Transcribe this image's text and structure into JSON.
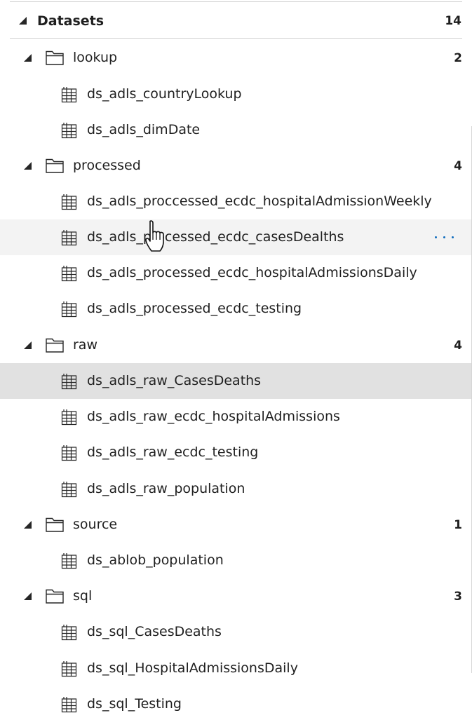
{
  "header": {
    "title": "Datasets",
    "count": "14"
  },
  "folders": [
    {
      "name": "lookup",
      "count": "2",
      "items": [
        "ds_adls_countryLookup",
        "ds_adls_dimDate"
      ]
    },
    {
      "name": "processed",
      "count": "4",
      "items": [
        "ds_adls_proccessed_ecdc_hospitalAdmissionWeekly",
        "ds_adls_processed_ecdc_casesDealths",
        "ds_adls_processed_ecdc_hospitalAdmissionsDaily",
        "ds_adls_processed_ecdc_testing"
      ]
    },
    {
      "name": "raw",
      "count": "4",
      "items": [
        "ds_adls_raw_CasesDeaths",
        "ds_adls_raw_ecdc_hospitalAdmissions",
        "ds_adls_raw_ecdc_testing",
        "ds_adls_raw_population"
      ]
    },
    {
      "name": "source",
      "count": "1",
      "items": [
        "ds_ablob_population"
      ]
    },
    {
      "name": "sql",
      "count": "3",
      "items": [
        "ds_sql_CasesDeaths",
        "ds_sql_HospitalAdmissionsDaily",
        "ds_sql_Testing"
      ]
    }
  ],
  "hovered_item": "ds_adls_processed_ecdc_casesDealths",
  "selected_item": "ds_adls_raw_CasesDeaths",
  "icons": {
    "expand": "triangle-expanded-icon",
    "folder": "folder-icon",
    "dataset": "table-icon",
    "more": "more-actions-icon",
    "cursor": "hand-pointer-cursor"
  },
  "colors": {
    "hover_background": "#f3f3f3",
    "selected_background": "#e1e1e1",
    "more_actions": "#0f6cbd"
  }
}
